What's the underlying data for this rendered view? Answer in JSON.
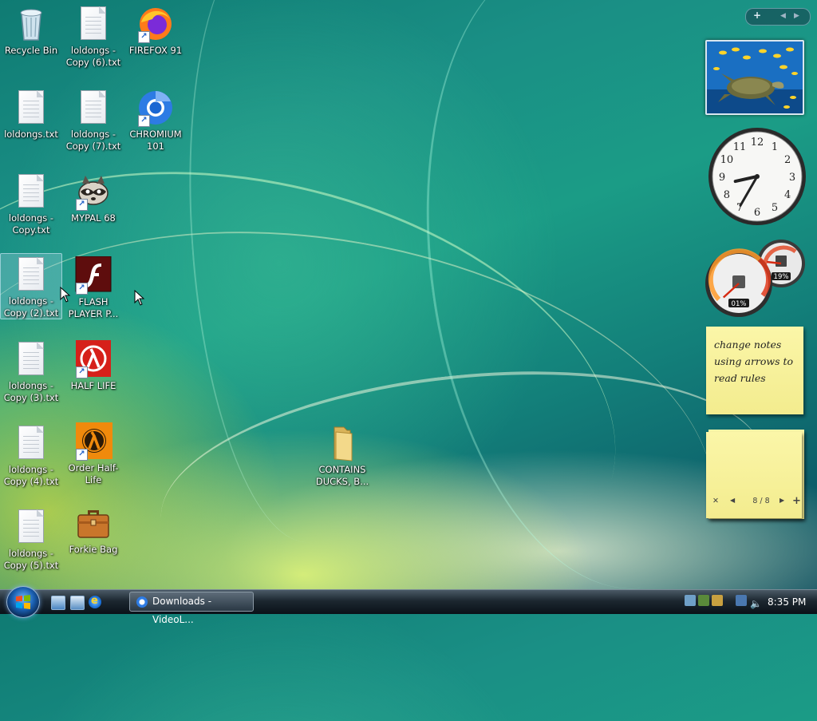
{
  "desktop": {
    "icons": [
      {
        "label": "Recycle Bin"
      },
      {
        "label": "loldongs - Copy (6).txt"
      },
      {
        "label": "FIREFOX 91"
      },
      {
        "label": "loldongs.txt"
      },
      {
        "label": "loldongs - Copy (7).txt"
      },
      {
        "label": "CHROMIUM 101"
      },
      {
        "label": "loldongs - Copy.txt"
      },
      {
        "label": "MYPAL 68"
      },
      {
        "label": "loldongs - Copy (2).txt"
      },
      {
        "label": "FLASH PLAYER P..."
      },
      {
        "label": "loldongs - Copy (3).txt"
      },
      {
        "label": "HALF LIFE"
      },
      {
        "label": "loldongs - Copy (4).txt"
      },
      {
        "label": "Order Half-Life"
      },
      {
        "label": "loldongs - Copy (5).txt"
      },
      {
        "label": "Forkie Bag"
      },
      {
        "label": "CONTAINS DUCKS, B..."
      }
    ]
  },
  "sidebar": {
    "toolbar": {
      "add": "+",
      "prev": "◀",
      "next": "▶"
    },
    "clock": {
      "numerals": [
        "12",
        "1",
        "2",
        "3",
        "4",
        "5",
        "6",
        "7",
        "8",
        "9",
        "10",
        "11"
      ],
      "hour": 8.58,
      "minute": 35
    },
    "meter": {
      "cpu": "01%",
      "memory": "19%",
      "cpu_level": 0.01,
      "memory_level": 0.19
    },
    "notes": {
      "text_lines": [
        "change notes",
        "using arrows to",
        "read rules"
      ],
      "close": "✕",
      "prev": "◀",
      "next": "▶",
      "add": "+",
      "counter": "8 / 8"
    }
  },
  "taskbar": {
    "window_button": "Downloads - VideoL...",
    "clock": "8:35 PM"
  },
  "colors": {
    "note": "#f5ee95",
    "taskbar": "#1c2730",
    "accent": "#1a5fb0"
  }
}
